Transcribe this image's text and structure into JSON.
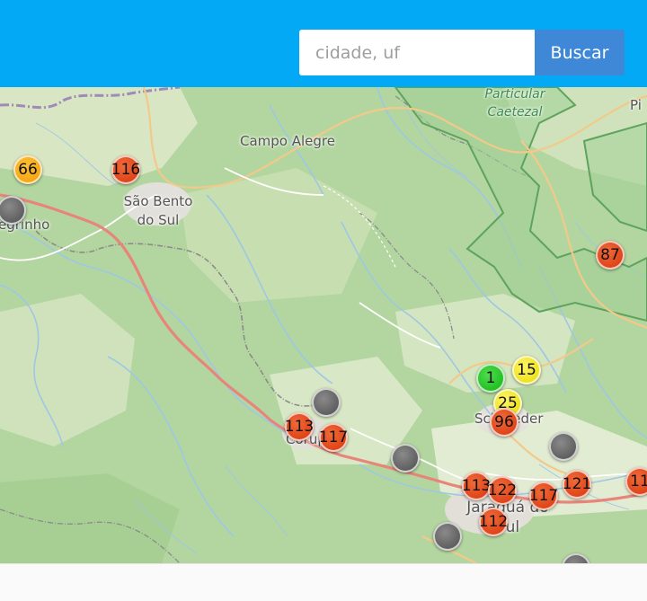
{
  "header": {
    "search_placeholder": "cidade, uf",
    "search_button": "Buscar"
  },
  "map": {
    "places": {
      "campo_alegre": "Campo Alegre",
      "sao_bento_line1": "São Bento",
      "sao_bento_line2": "do Sul",
      "rio_negrinho": "egrinho",
      "park_line1": "Particular",
      "park_line2": "Caetezal",
      "pi": "Pi",
      "schroeder": "Schroeder",
      "corupa": "Corupá",
      "jaragua_line1": "Jaraguá do",
      "jaragua_line2": "Sul"
    },
    "markers": [
      {
        "label": "66",
        "color": "orange"
      },
      {
        "label": "116",
        "color": "red"
      },
      {
        "label": "",
        "color": "gray"
      },
      {
        "label": "87",
        "color": "red"
      },
      {
        "label": "1",
        "color": "green"
      },
      {
        "label": "15",
        "color": "yellow"
      },
      {
        "label": "25",
        "color": "yellow"
      },
      {
        "label": "96",
        "color": "red"
      },
      {
        "label": "",
        "color": "gray"
      },
      {
        "label": "113",
        "color": "red"
      },
      {
        "label": "117",
        "color": "red"
      },
      {
        "label": "",
        "color": "gray"
      },
      {
        "label": "",
        "color": "gray"
      },
      {
        "label": "113",
        "color": "red"
      },
      {
        "label": "122",
        "color": "red"
      },
      {
        "label": "117",
        "color": "red"
      },
      {
        "label": "121",
        "color": "red"
      },
      {
        "label": "11",
        "color": "red"
      },
      {
        "label": "112",
        "color": "red"
      },
      {
        "label": "",
        "color": "gray"
      },
      {
        "label": "",
        "color": "gray"
      }
    ]
  }
}
